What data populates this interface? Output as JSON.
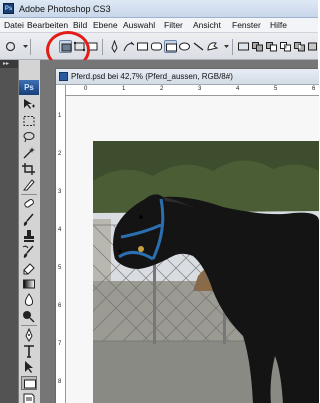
{
  "app": {
    "title": "Adobe Photoshop CS3",
    "logo_text": "Ps"
  },
  "menu": {
    "items": [
      "Datei",
      "Bearbeiten",
      "Bild",
      "Ebene",
      "Auswahl",
      "Filter",
      "Ansicht",
      "Fenster",
      "Hilfe"
    ]
  },
  "toolbox": {
    "badge": "Ps",
    "grip": "▸▸"
  },
  "document": {
    "title": "Pferd.psd bei 42,7% (Pferd_aussen, RGB/8#)",
    "zoom": "42,7%",
    "ruler_h": [
      "0",
      "1",
      "2",
      "3",
      "4",
      "5",
      "6"
    ],
    "ruler_v": [
      "1",
      "2",
      "3",
      "4",
      "5",
      "6",
      "7",
      "8",
      "9"
    ]
  },
  "colors": {
    "annotation": "#e41b17",
    "toolbox_bg": "#535353",
    "workspace_bg": "#767676"
  }
}
